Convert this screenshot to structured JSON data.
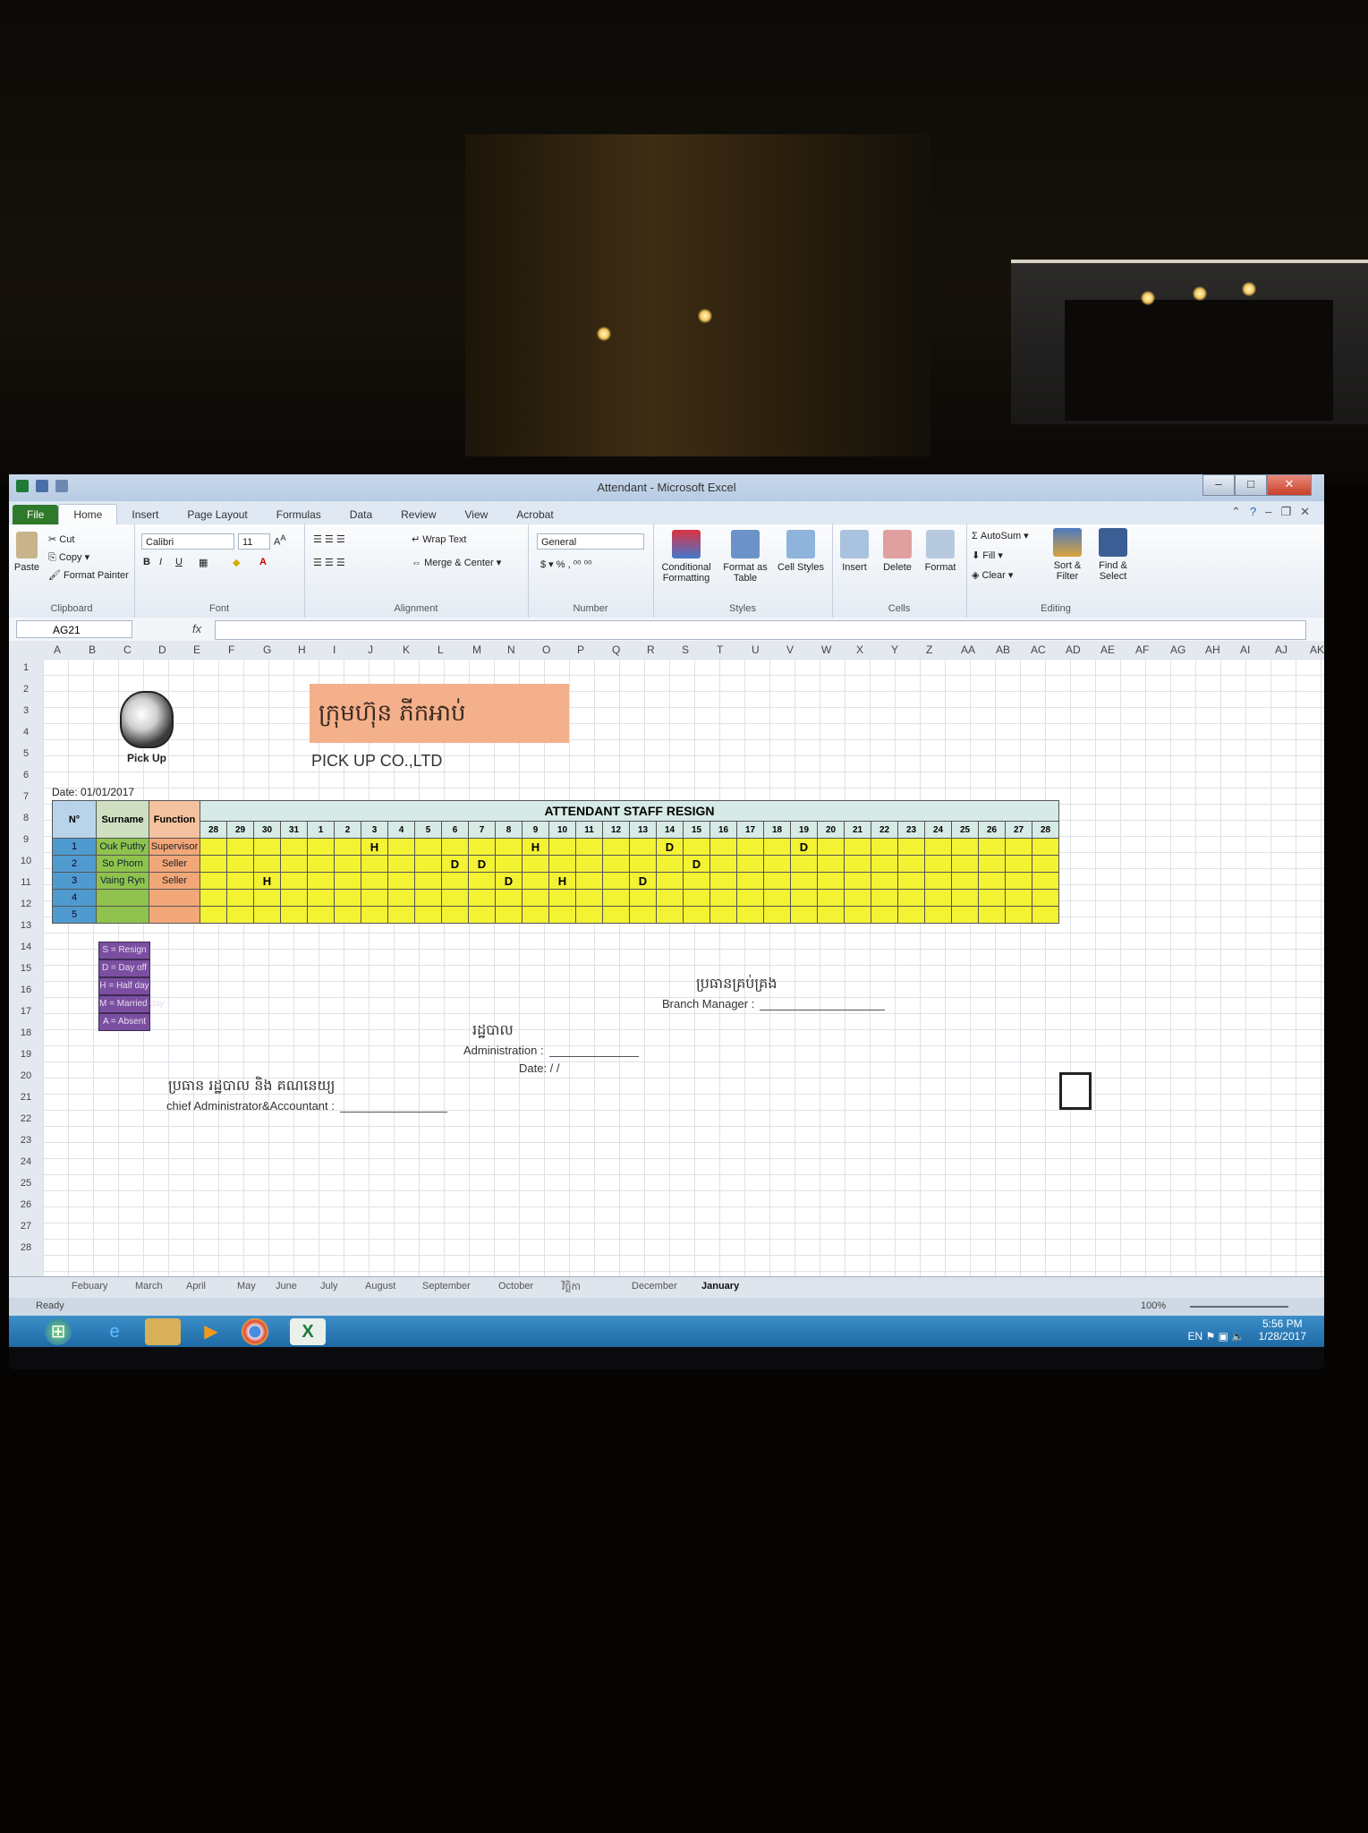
{
  "window": {
    "title": "Attendant - Microsoft Excel"
  },
  "tabs": [
    "File",
    "Home",
    "Insert",
    "Page Layout",
    "Formulas",
    "Data",
    "Review",
    "View",
    "Acrobat"
  ],
  "ribbon": {
    "clipboard": {
      "paste": "Paste",
      "cut": "Cut",
      "copy": "Copy",
      "format_painter": "Format Painter",
      "label": "Clipboard"
    },
    "font": {
      "name": "Calibri",
      "size": "11",
      "label": "Font"
    },
    "alignment": {
      "wrap": "Wrap Text",
      "merge": "Merge & Center",
      "label": "Alignment"
    },
    "number": {
      "format": "General",
      "label": "Number"
    },
    "styles": {
      "conditional": "Conditional Formatting",
      "as_table": "Format as Table",
      "cell_styles": "Cell Styles",
      "label": "Styles"
    },
    "cells": {
      "insert": "Insert",
      "delete": "Delete",
      "format": "Format",
      "label": "Cells"
    },
    "editing": {
      "autosum": "AutoSum",
      "fill": "Fill",
      "clear": "Clear",
      "sort": "Sort & Filter",
      "find": "Find & Select",
      "label": "Editing"
    }
  },
  "formula_bar": {
    "name_box": "AG21",
    "fx": "fx"
  },
  "columns": [
    "A",
    "B",
    "C",
    "D",
    "E",
    "F",
    "G",
    "H",
    "I",
    "J",
    "K",
    "L",
    "M",
    "N",
    "O",
    "P",
    "Q",
    "R",
    "S",
    "T",
    "U",
    "V",
    "W",
    "X",
    "Y",
    "Z",
    "AA",
    "AB",
    "AC",
    "AD",
    "AE",
    "AF",
    "AG",
    "AH",
    "AI",
    "AJ",
    "AK"
  ],
  "rows": [
    "1",
    "2",
    "3",
    "4",
    "5",
    "6",
    "7",
    "8",
    "9",
    "10",
    "11",
    "12",
    "13",
    "14",
    "15",
    "16",
    "17",
    "18",
    "19",
    "20",
    "21",
    "22",
    "23",
    "24",
    "25",
    "26",
    "27",
    "28"
  ],
  "sheet": {
    "logo_text": "Pick Up",
    "company_kh": "ក្រុមហ៊ុន ភីកអាប់",
    "company_en": "PICK UP CO.,LTD",
    "date": "Date:  01/01/2017",
    "table_title": "ATTENDANT STAFF RESIGN",
    "headers": {
      "no": "N°",
      "surname": "Surname",
      "function": "Function"
    },
    "days": [
      "28",
      "29",
      "30",
      "31",
      "1",
      "2",
      "3",
      "4",
      "5",
      "6",
      "7",
      "8",
      "9",
      "10",
      "11",
      "12",
      "13",
      "14",
      "15",
      "16",
      "17",
      "18",
      "19",
      "20",
      "21",
      "22",
      "23",
      "24",
      "25",
      "26",
      "27",
      "28"
    ],
    "staff": [
      {
        "no": "1",
        "surname": "Ouk Puthy",
        "function": "Supervisor",
        "marks": [
          "",
          "",
          "",
          "",
          "",
          "",
          "H",
          "",
          "",
          "",
          "",
          "",
          "H",
          "",
          "",
          "",
          "",
          "D",
          "",
          "",
          "",
          "",
          "D",
          "",
          "",
          "",
          "",
          "",
          "",
          "",
          "",
          ""
        ]
      },
      {
        "no": "2",
        "surname": "So Phorn",
        "function": "Seller",
        "marks": [
          "",
          "",
          "",
          "",
          "",
          "",
          "",
          "",
          "",
          "D",
          "D",
          "",
          "",
          "",
          "",
          "",
          "",
          "",
          "D",
          "",
          "",
          "",
          "",
          "",
          "",
          "",
          "",
          "",
          "",
          "",
          "",
          ""
        ]
      },
      {
        "no": "3",
        "surname": "Vaing Ryn",
        "function": "Seller",
        "marks": [
          "",
          "",
          "H",
          "",
          "",
          "",
          "",
          "",
          "",
          "",
          "",
          "D",
          "",
          "H",
          "",
          "",
          "D",
          "",
          "",
          "",
          "",
          "",
          "",
          "",
          "",
          "",
          "",
          "",
          "",
          "",
          "",
          ""
        ]
      },
      {
        "no": "4",
        "surname": "",
        "function": "",
        "marks": [
          "",
          "",
          "",
          "",
          "",
          "",
          "",
          "",
          "",
          "",
          "",
          "",
          "",
          "",
          "",
          "",
          "",
          "",
          "",
          "",
          "",
          "",
          "",
          "",
          "",
          "",
          "",
          "",
          "",
          "",
          "",
          ""
        ]
      },
      {
        "no": "5",
        "surname": "",
        "function": "",
        "marks": [
          "",
          "",
          "",
          "",
          "",
          "",
          "",
          "",
          "",
          "",
          "",
          "",
          "",
          "",
          "",
          "",
          "",
          "",
          "",
          "",
          "",
          "",
          "",
          "",
          "",
          "",
          "",
          "",
          "",
          "",
          "",
          ""
        ]
      }
    ],
    "legend": [
      "S = Resign",
      "D = Day off",
      "H = Half day",
      "M = Married day",
      "A = Absent"
    ],
    "branch_manager_kh": "ប្រធានគ្រប់គ្រង",
    "branch_manager": "Branch Manager :",
    "admin_kh": "រដ្ឋបាល",
    "administration": "Administration :",
    "admin_date": "Date:     /     /",
    "chief_kh": "ប្រធាន រដ្ឋបាល និង គណនេយ្យ",
    "chief": "chief Administrator&Accountant :"
  },
  "sheet_tabs": [
    "Febuary",
    "March",
    "April",
    "May",
    "June",
    "July",
    "August",
    "September",
    "October",
    "វិច្ឆិកា",
    "December",
    "January"
  ],
  "active_sheet": "January",
  "status": {
    "ready": "Ready",
    "zoom": "100%"
  },
  "tray": {
    "lang": "EN",
    "time": "5:56 PM",
    "date": "1/28/2017"
  }
}
